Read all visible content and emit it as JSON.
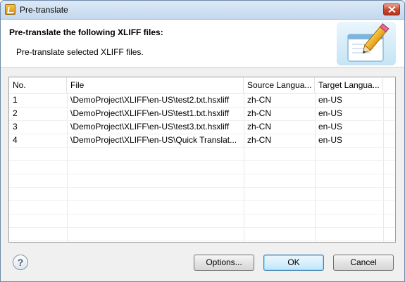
{
  "window": {
    "title": "Pre-translate"
  },
  "header": {
    "title": "Pre-translate the following XLIFF files:",
    "description": "Pre-translate selected XLIFF files."
  },
  "table": {
    "columns": [
      "No.",
      "File",
      "Source Langua...",
      "Target Langua..."
    ],
    "rows": [
      [
        "1",
        "\\DemoProject\\XLIFF\\en-US\\test2.txt.hsxliff",
        "zh-CN",
        "en-US"
      ],
      [
        "2",
        "\\DemoProject\\XLIFF\\en-US\\test1.txt.hsxliff",
        "zh-CN",
        "en-US"
      ],
      [
        "3",
        "\\DemoProject\\XLIFF\\en-US\\test3.txt.hsxliff",
        "zh-CN",
        "en-US"
      ],
      [
        "4",
        "\\DemoProject\\XLIFF\\en-US\\Quick Translat...",
        "zh-CN",
        "en-US"
      ]
    ]
  },
  "footer": {
    "help_glyph": "?",
    "options_label": "Options...",
    "ok_label": "OK",
    "cancel_label": "Cancel"
  },
  "icons": {
    "title_icon": "app-logo-icon",
    "close": "close-icon",
    "banner": "edit-pencil-icon",
    "help": "help-icon"
  }
}
